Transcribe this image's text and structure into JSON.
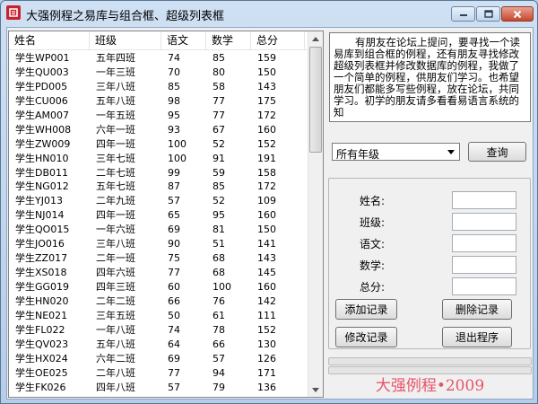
{
  "window": {
    "title": "大强例程之易库与组合框、超级列表框",
    "accent_close": "#c7462b"
  },
  "list": {
    "columns": [
      "姓名",
      "班级",
      "语文",
      "数学",
      "总分"
    ],
    "rows": [
      [
        "学生WP001",
        "五年四班",
        "74",
        "85",
        "159"
      ],
      [
        "学生QU003",
        "一年三班",
        "70",
        "80",
        "150"
      ],
      [
        "学生PD005",
        "三年八班",
        "85",
        "58",
        "143"
      ],
      [
        "学生CU006",
        "五年八班",
        "98",
        "77",
        "175"
      ],
      [
        "学生AM007",
        "一年五班",
        "95",
        "77",
        "172"
      ],
      [
        "学生WH008",
        "六年一班",
        "93",
        "67",
        "160"
      ],
      [
        "学生ZW009",
        "四年一班",
        "100",
        "52",
        "152"
      ],
      [
        "学生HN010",
        "三年七班",
        "100",
        "91",
        "191"
      ],
      [
        "学生DB011",
        "二年七班",
        "99",
        "59",
        "158"
      ],
      [
        "学生NG012",
        "五年七班",
        "87",
        "85",
        "172"
      ],
      [
        "学生YJ013",
        "二年九班",
        "57",
        "52",
        "109"
      ],
      [
        "学生NJ014",
        "四年一班",
        "65",
        "95",
        "160"
      ],
      [
        "学生QO015",
        "一年六班",
        "69",
        "81",
        "150"
      ],
      [
        "学生JO016",
        "三年八班",
        "90",
        "51",
        "141"
      ],
      [
        "学生ZZ017",
        "二年一班",
        "75",
        "68",
        "143"
      ],
      [
        "学生XS018",
        "四年六班",
        "77",
        "68",
        "145"
      ],
      [
        "学生GG019",
        "四年三班",
        "60",
        "100",
        "160"
      ],
      [
        "学生HN020",
        "二年二班",
        "66",
        "76",
        "142"
      ],
      [
        "学生NE021",
        "三年五班",
        "50",
        "61",
        "111"
      ],
      [
        "学生FL022",
        "一年八班",
        "74",
        "78",
        "152"
      ],
      [
        "学生QV023",
        "五年八班",
        "64",
        "66",
        "130"
      ],
      [
        "学生HX024",
        "六年二班",
        "69",
        "57",
        "126"
      ],
      [
        "学生OE025",
        "二年八班",
        "77",
        "94",
        "171"
      ],
      [
        "学生FK026",
        "四年八班",
        "57",
        "79",
        "136"
      ]
    ]
  },
  "intro_text": "有朋友在论坛上提问，要寻找一个读易库到组合框的例程，还有朋友寻找修改超级列表框并修改数据库的例程，我做了一个简单的例程，供朋友们学习。也希望朋友们都能多写些例程，放在论坛，共同学习。初学的朋友请多看看易语言系统的知",
  "filter": {
    "selected": "所有年级",
    "query_label": "查询"
  },
  "form": {
    "name_label": "姓名:",
    "class_label": "班级:",
    "chinese_label": "语文:",
    "math_label": "数学:",
    "total_label": "总分:"
  },
  "buttons": {
    "add": "添加记录",
    "delete": "删除记录",
    "edit": "修改记录",
    "exit": "退出程序"
  },
  "footer_text": "大强例程•2009",
  "footer_color": "#e8546a"
}
